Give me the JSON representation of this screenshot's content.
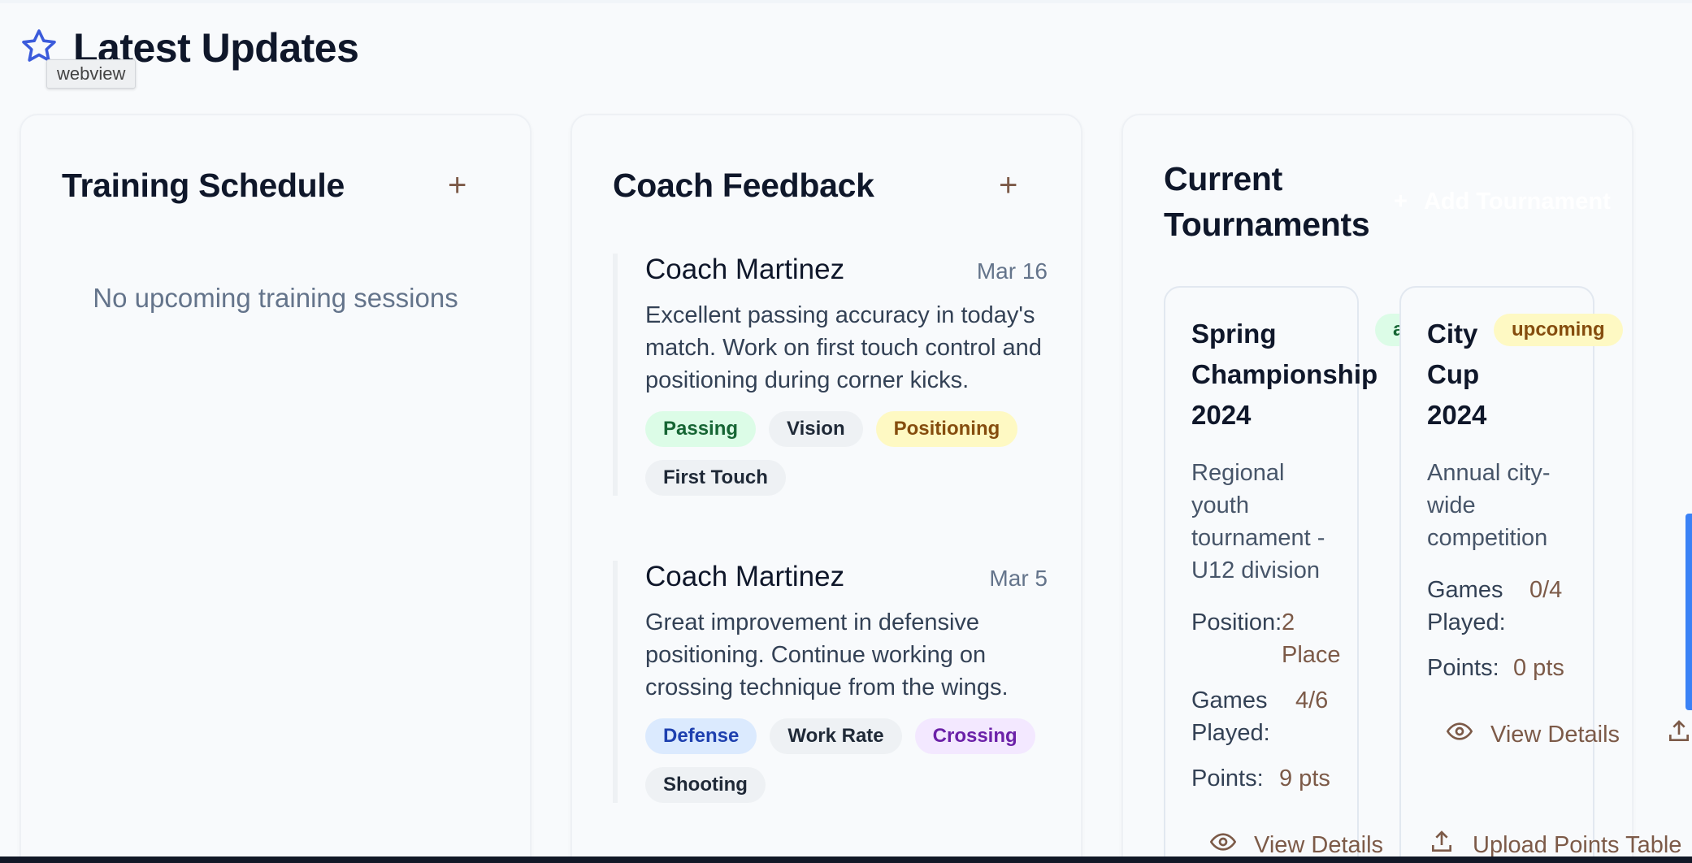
{
  "page": {
    "title": "Latest Updates",
    "tooltip": "webview"
  },
  "training": {
    "title": "Training Schedule",
    "add_label": "+",
    "empty": "No upcoming training sessions"
  },
  "feedback": {
    "title": "Coach Feedback",
    "add_label": "+",
    "items": [
      {
        "coach": "Coach Martinez",
        "date": "Mar 16",
        "text": "Excellent passing accuracy in today's match. Work on first touch control and positioning during corner kicks.",
        "tags": [
          "Passing",
          "Vision",
          "Positioning",
          "First Touch"
        ]
      },
      {
        "coach": "Coach Martinez",
        "date": "Mar 5",
        "text": "Great improvement in defensive positioning. Continue working on crossing technique from the wings.",
        "tags": [
          "Defense",
          "Work Rate",
          "Crossing",
          "Shooting"
        ]
      }
    ]
  },
  "tournaments": {
    "title_line1": "Current",
    "title_line2": "Tournaments",
    "add_icon": "+",
    "add_label": "Add Tournament",
    "items": [
      {
        "name_lines": [
          "Spring",
          "Championship",
          "2024"
        ],
        "status": "active",
        "desc_lines": [
          "Regional",
          "youth",
          "tournament -",
          "U12 division"
        ],
        "position_label": "Position:",
        "position_value_lines": [
          "2",
          "Place"
        ],
        "games_label_lines": [
          "Games",
          "Played:"
        ],
        "games_value": "4/6",
        "points_label": "Points:",
        "points_value": "9 pts",
        "view_label": "View Details",
        "upload_label": "Upload Points Table"
      },
      {
        "name_lines": [
          "City",
          "Cup",
          "2024"
        ],
        "status": "upcoming",
        "desc_lines": [
          "Annual city-",
          "wide",
          "competition"
        ],
        "games_label_lines": [
          "Games",
          "Played:"
        ],
        "games_value": "0/4",
        "points_label": "Points:",
        "points_value": "0 pts",
        "view_label": "View Details"
      }
    ]
  },
  "colors": {
    "accent": "#7c5a48",
    "star": "#3b5bdb",
    "scroll": "#3b82f6"
  },
  "icons": {
    "star": "star-icon",
    "eye": "eye-icon",
    "upload": "upload-icon",
    "plus": "plus-icon"
  }
}
